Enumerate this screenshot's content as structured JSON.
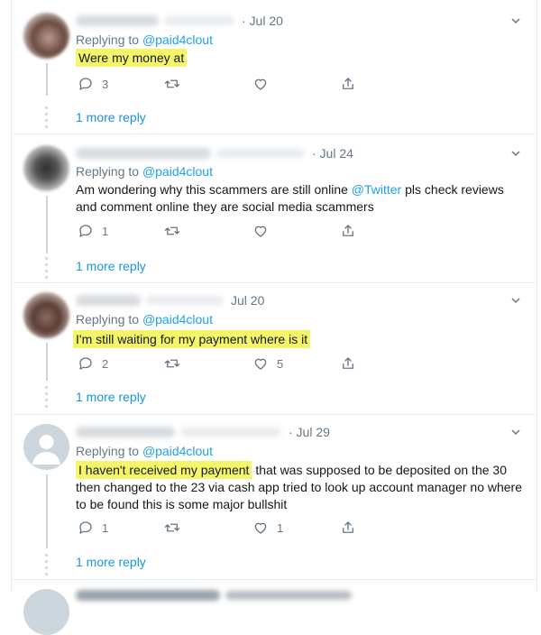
{
  "tweets": [
    {
      "date": "· Jul 20",
      "replying_prefix": "Replying to",
      "replying_handle": "@paid4clout",
      "text_highlight": "Were my money at",
      "text_rest": "",
      "reply_count": "3",
      "retweet_count": "",
      "like_count": "",
      "more_reply": "1 more reply"
    },
    {
      "date": "· Jul 24",
      "replying_prefix": "Replying to",
      "replying_handle": "@paid4clout",
      "text_part1": "Am wondering why this scammers are still online",
      "text_mention": "@Twitter",
      "text_part2": "pls check reviews and comment online they are social media scammers",
      "reply_count": "1",
      "retweet_count": "",
      "like_count": "",
      "more_reply": "1 more reply"
    },
    {
      "date": "Jul 20",
      "replying_prefix": "Replying to",
      "replying_handle": "@paid4clout",
      "text_highlight": "I'm still waiting for my payment where is it",
      "reply_count": "2",
      "retweet_count": "",
      "like_count": "5",
      "more_reply": "1 more reply"
    },
    {
      "date": "· Jul 29",
      "replying_prefix": "Replying to",
      "replying_handle": "@paid4clout",
      "text_highlight": "I haven't received my payment",
      "text_rest": "that was supposed to be deposited on the 30 then changed to the 23 via cash app tried to look up account manager no where to be found this is some major bullshit",
      "reply_count": "1",
      "retweet_count": "",
      "like_count": "1",
      "more_reply": "1 more reply"
    }
  ],
  "colors": {
    "accent": "#1da1f2",
    "highlight": "#f5f56a",
    "muted": "#657786",
    "border": "#e6ecf0"
  },
  "icons": [
    "reply-icon",
    "retweet-icon",
    "like-icon",
    "share-icon",
    "chevron-down-icon"
  ]
}
